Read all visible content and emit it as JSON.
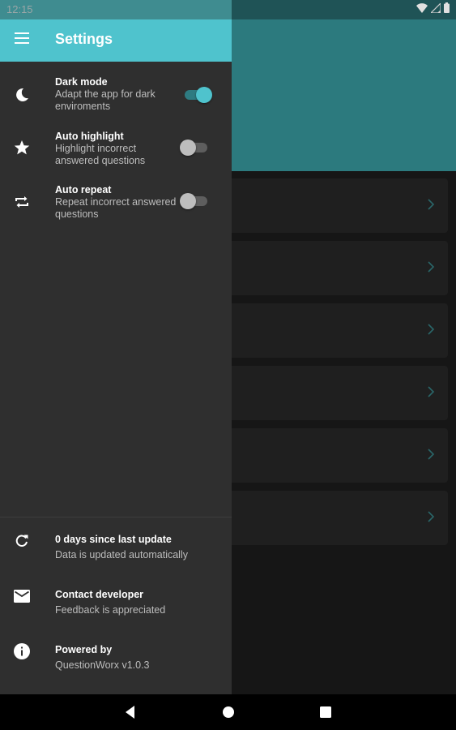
{
  "status_bar": {
    "time": "12:15"
  },
  "drawer": {
    "title": "Settings",
    "settings": [
      {
        "title": "Dark mode",
        "subtitle": "Adapt the app for dark enviroments",
        "icon": "moon-icon",
        "enabled": true
      },
      {
        "title": "Auto highlight",
        "subtitle": "Highlight incorrect answered questions",
        "icon": "star-icon",
        "enabled": false
      },
      {
        "title": "Auto repeat",
        "subtitle": "Repeat incorrect answered questions",
        "icon": "repeat-icon",
        "enabled": false
      }
    ],
    "info": [
      {
        "title": "0 days since last update",
        "subtitle": "Data is updated automatically",
        "icon": "refresh-icon"
      },
      {
        "title": "Contact developer",
        "subtitle": "Feedback is appreciated",
        "icon": "mail-icon"
      },
      {
        "title": "Powered by",
        "subtitle": "QuestionWorx v1.0.3",
        "icon": "info-icon"
      }
    ]
  },
  "colors": {
    "accent": "#4fc3cd",
    "drawer_bg": "#2f2f2f",
    "header_bg": "#2c7a7e"
  }
}
